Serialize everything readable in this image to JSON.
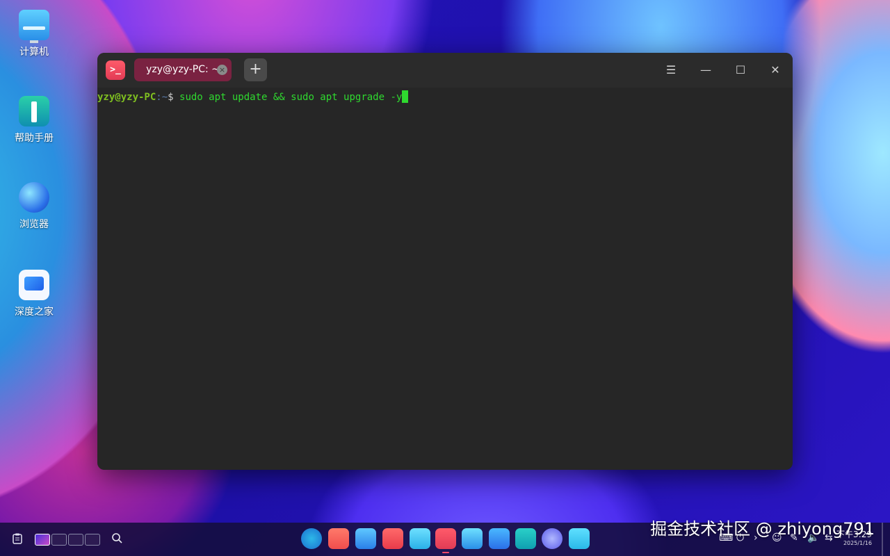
{
  "desktop": {
    "icons": [
      {
        "label": "计算机"
      },
      {
        "label": "帮助手册"
      },
      {
        "label": "浏览器"
      },
      {
        "label": "深度之家"
      }
    ]
  },
  "terminal": {
    "tab_title": "yzy@yzy-PC: ~",
    "tab_close": "×",
    "new_tab": "+",
    "prompt_user": "yzy@yzy-PC",
    "prompt_path": ":~",
    "prompt_symbol": "$",
    "command": " sudo apt update && sudo apt upgrade -y",
    "app_icon": ">_"
  },
  "window_controls": {
    "menu": "☰",
    "minimize": "—",
    "maximize": "☐",
    "close": "✕"
  },
  "taskbar": {
    "search_icon": "search-icon",
    "clock_date": "2025/1/16",
    "clock_time": "下午3:29",
    "dock_apps": [
      "launcher",
      "app-store",
      "file-manager",
      "app-gift",
      "mail",
      "terminal",
      "music",
      "text-editor",
      "calculator",
      "settings",
      "trash"
    ]
  },
  "watermark": "掘金技术社区 @ zhiyong791",
  "colors": {
    "accent_tab": "#7a2241",
    "prompt_user": "#7fbf20",
    "command_text": "#2fd82f"
  }
}
